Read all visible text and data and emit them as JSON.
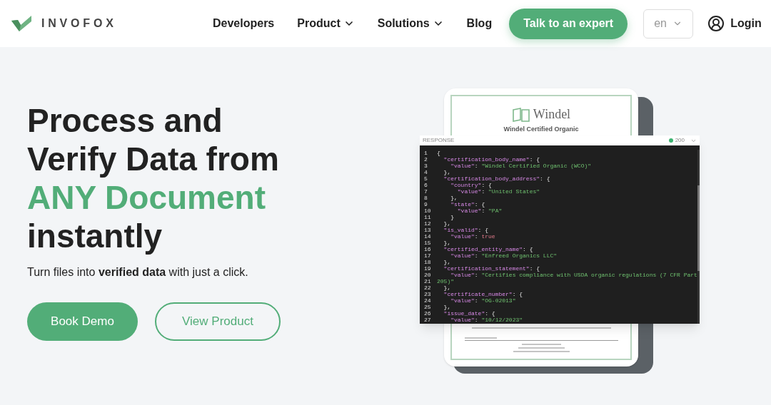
{
  "header": {
    "logo": "INVOFOX",
    "nav": [
      {
        "label": "Developers",
        "dropdown": false
      },
      {
        "label": "Product",
        "dropdown": true
      },
      {
        "label": "Solutions",
        "dropdown": true
      },
      {
        "label": "Blog",
        "dropdown": false
      }
    ],
    "cta": "Talk to an expert",
    "language": "en",
    "login": "Login"
  },
  "hero": {
    "headline": [
      {
        "text": "Process and",
        "accent": false
      },
      {
        "text": "Verify Data from",
        "accent": false
      },
      {
        "text": "ANY Document",
        "accent": true
      },
      {
        "text": "instantly",
        "accent": false
      }
    ],
    "subtitle": "Turn files into **verified data** with just a click.",
    "buttons": [
      {
        "label": "Book Demo",
        "kind": "primary"
      },
      {
        "label": "View Product",
        "kind": "outline"
      }
    ]
  },
  "document": {
    "brand": "Windel",
    "title": "Windel Certified Organic"
  },
  "response": {
    "title": "RESPONSE",
    "status": "200",
    "lines": [
      {
        "n": "1",
        "tokens": [
          {
            "kind": "punct",
            "text": "{"
          }
        ]
      },
      {
        "n": "2",
        "tokens": [
          {
            "kind": "key",
            "text": "  \"certification_body_name\""
          },
          {
            "kind": "punct",
            "text": ": {"
          }
        ]
      },
      {
        "n": "3",
        "tokens": [
          {
            "kind": "key",
            "text": "    \"value\""
          },
          {
            "kind": "punct",
            "text": ": "
          },
          {
            "kind": "string",
            "text": "\"Windel Certified Organic (WCO)\""
          }
        ]
      },
      {
        "n": "4",
        "tokens": [
          {
            "kind": "punct",
            "text": "  },"
          }
        ]
      },
      {
        "n": "5",
        "tokens": [
          {
            "kind": "key",
            "text": "  \"certification_body_address\""
          },
          {
            "kind": "punct",
            "text": ": {"
          }
        ]
      },
      {
        "n": "6",
        "tokens": [
          {
            "kind": "key",
            "text": "    \"country\""
          },
          {
            "kind": "punct",
            "text": ": {"
          }
        ]
      },
      {
        "n": "7",
        "tokens": [
          {
            "kind": "key",
            "text": "      \"value\""
          },
          {
            "kind": "punct",
            "text": ": "
          },
          {
            "kind": "string",
            "text": "\"United States\""
          }
        ]
      },
      {
        "n": "8",
        "tokens": [
          {
            "kind": "punct",
            "text": "    },"
          }
        ]
      },
      {
        "n": "9",
        "tokens": [
          {
            "kind": "key",
            "text": "    \"state\""
          },
          {
            "kind": "punct",
            "text": ": {"
          }
        ]
      },
      {
        "n": "10",
        "tokens": [
          {
            "kind": "key",
            "text": "      \"value\""
          },
          {
            "kind": "punct",
            "text": ": "
          },
          {
            "kind": "string",
            "text": "\"PA\""
          }
        ]
      },
      {
        "n": "11",
        "tokens": [
          {
            "kind": "punct",
            "text": "    }"
          }
        ]
      },
      {
        "n": "12",
        "tokens": [
          {
            "kind": "punct",
            "text": "  },"
          }
        ]
      },
      {
        "n": "13",
        "tokens": [
          {
            "kind": "key",
            "text": "  \"is_valid\""
          },
          {
            "kind": "punct",
            "text": ": {"
          }
        ]
      },
      {
        "n": "14",
        "tokens": [
          {
            "kind": "key",
            "text": "    \"value\""
          },
          {
            "kind": "punct",
            "text": ": "
          },
          {
            "kind": "bool",
            "text": "true"
          }
        ]
      },
      {
        "n": "15",
        "tokens": [
          {
            "kind": "punct",
            "text": "  },"
          }
        ]
      },
      {
        "n": "16",
        "tokens": [
          {
            "kind": "key",
            "text": "  \"certified_entity_name\""
          },
          {
            "kind": "punct",
            "text": ": {"
          }
        ]
      },
      {
        "n": "17",
        "tokens": [
          {
            "kind": "key",
            "text": "    \"value\""
          },
          {
            "kind": "punct",
            "text": ": "
          },
          {
            "kind": "string",
            "text": "\"Enfreed Organics LLC\""
          }
        ]
      },
      {
        "n": "18",
        "tokens": [
          {
            "kind": "punct",
            "text": "  },"
          }
        ]
      },
      {
        "n": "19",
        "tokens": [
          {
            "kind": "key",
            "text": "  \"certification_statement\""
          },
          {
            "kind": "punct",
            "text": ": {"
          }
        ]
      },
      {
        "n": "20",
        "tokens": [
          {
            "kind": "key",
            "text": "    \"value\""
          },
          {
            "kind": "punct",
            "text": ": "
          },
          {
            "kind": "string",
            "text": "\"Certifies compliance with USDA organic regulations (7 CFR Part"
          }
        ]
      },
      {
        "n": "21",
        "tokens": [
          {
            "kind": "string",
            "text": "205)\""
          }
        ]
      },
      {
        "n": "22",
        "tokens": [
          {
            "kind": "punct",
            "text": "  },"
          }
        ]
      },
      {
        "n": "23",
        "tokens": [
          {
            "kind": "key",
            "text": "  \"certificate_number\""
          },
          {
            "kind": "punct",
            "text": ": {"
          }
        ]
      },
      {
        "n": "24",
        "tokens": [
          {
            "kind": "key",
            "text": "    \"value\""
          },
          {
            "kind": "punct",
            "text": ": "
          },
          {
            "kind": "string",
            "text": "\"OG-02013\""
          }
        ]
      },
      {
        "n": "25",
        "tokens": [
          {
            "kind": "punct",
            "text": "  },"
          }
        ]
      },
      {
        "n": "26",
        "tokens": [
          {
            "kind": "key",
            "text": "  \"issue_date\""
          },
          {
            "kind": "punct",
            "text": ": {"
          }
        ]
      },
      {
        "n": "27",
        "tokens": [
          {
            "kind": "key",
            "text": "    \"value\""
          },
          {
            "kind": "punct",
            "text": ": "
          },
          {
            "kind": "string",
            "text": "\"10/12/2023\""
          }
        ]
      }
    ]
  }
}
